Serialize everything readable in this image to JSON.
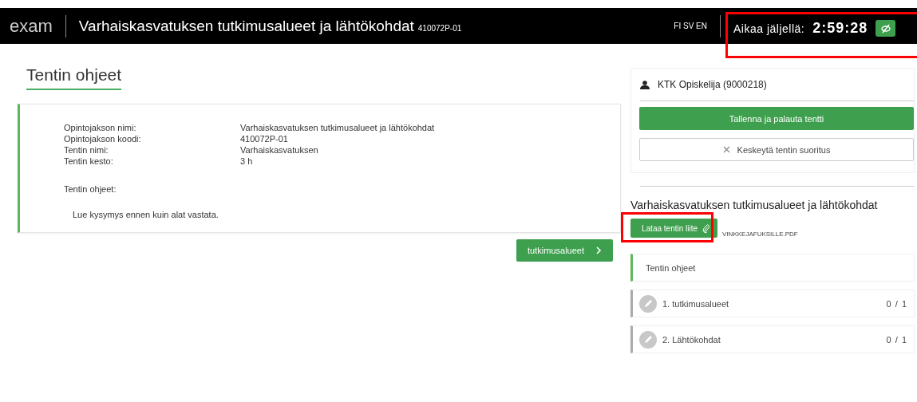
{
  "header": {
    "logo": "exam",
    "title": "Varhaiskasvatuksen tutkimusalueet ja lähtökohdat",
    "code": "410072P-01",
    "languages": "FI SV EN",
    "timer": {
      "label": "Aikaa jäljellä:",
      "time": "2:59:28",
      "highlighted": true
    }
  },
  "page_title": "Tentin ohjeet",
  "info": {
    "fields": [
      {
        "label": "Opintojakson nimi:",
        "value": "Varhaiskasvatuksen tutkimusalueet ja lähtökohdat"
      },
      {
        "label": "Opintojakson koodi:",
        "value": "410072P-01"
      },
      {
        "label": "Tentin nimi:",
        "value": "Varhaiskasvatuksen"
      },
      {
        "label": "Tentin kesto:",
        "value": "3 h"
      }
    ],
    "instructions_label": "Tentin ohjeet:",
    "instructions": "Lue kysymys ennen kuin alat vastata."
  },
  "next_button": "tutkimusalueet",
  "sidebar": {
    "user": "KTK Opiskelija (9000218)",
    "submit_button": "Tallenna ja palauta tentti",
    "abort_button": "Keskeytä tentin suoritus",
    "exam_title": "Varhaiskasvatuksen tutkimusalueet ja lähtökohdat",
    "attachment": {
      "button": "Lataa tentin liite",
      "file": "VINKKEJAFUKSILLE.PDF",
      "highlighted": true
    },
    "sections": [
      {
        "label": "Tentin ohjeet",
        "kind": "intro",
        "selected": true
      },
      {
        "label": "1. tutkimusalueet",
        "kind": "question",
        "score": "0 / 1",
        "selected": false
      },
      {
        "label": "2. Lähtökohdat",
        "kind": "question",
        "score": "0 / 1",
        "selected": false
      }
    ]
  }
}
